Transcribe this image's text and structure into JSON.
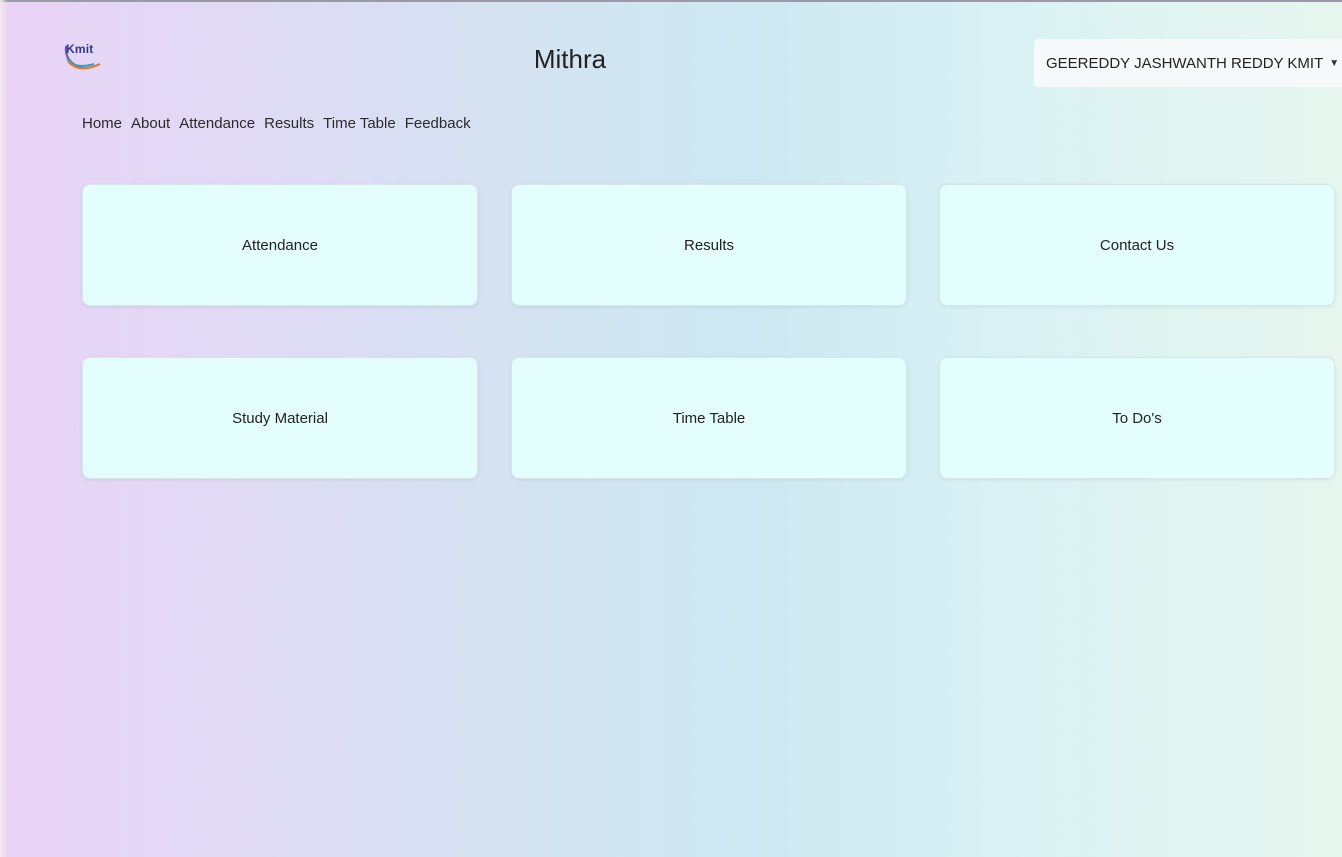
{
  "brand": {
    "logo_text": "Kmit",
    "app_title": "Mithra"
  },
  "user_menu": {
    "label": "GEEREDDY JASHWANTH REDDY KMIT",
    "caret_icon": "caret-down-icon"
  },
  "nav": {
    "items": [
      {
        "label": "Home"
      },
      {
        "label": "About"
      },
      {
        "label": "Attendance"
      },
      {
        "label": "Results"
      },
      {
        "label": "Time Table"
      },
      {
        "label": "Feedback"
      }
    ]
  },
  "cards": [
    {
      "label": "Attendance"
    },
    {
      "label": "Results"
    },
    {
      "label": "Contact Us"
    },
    {
      "label": "Study Material"
    },
    {
      "label": "Time Table"
    },
    {
      "label": "To Do's"
    }
  ],
  "colors": {
    "card_background": "#e4fdfd",
    "gradient_left": "#ead3f6",
    "gradient_middle": "#cde8f2",
    "gradient_right": "#e6f6ee"
  }
}
